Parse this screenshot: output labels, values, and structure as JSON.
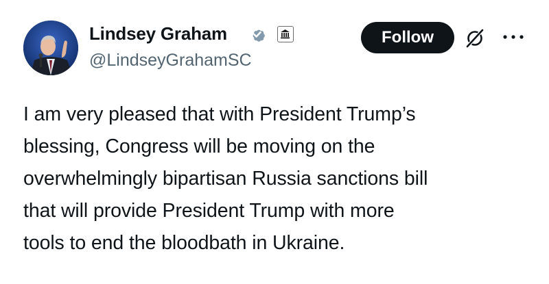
{
  "author": {
    "name": "Lindsey Graham",
    "handle": "@LindseyGrahamSC",
    "verified_icon": "verified-badge-icon",
    "affiliation_icon": "government-building-icon",
    "avatar_icon": "profile-photo"
  },
  "actions": {
    "follow_label": "Follow",
    "grok_icon": "grok-icon",
    "more_icon": "more-options-icon"
  },
  "tweet": {
    "lines": [
      "I am very pleased that with President Trump’s",
      "blessing, Congress will be moving on the",
      "overwhelmingly bipartisan Russia sanctions bill",
      "that will provide President Trump with more",
      "tools to end the bloodbath in Ukraine."
    ]
  },
  "colors": {
    "text": "#0f1419",
    "secondary": "#536471",
    "follow_bg": "#0f1419",
    "verified": "#829aab"
  }
}
